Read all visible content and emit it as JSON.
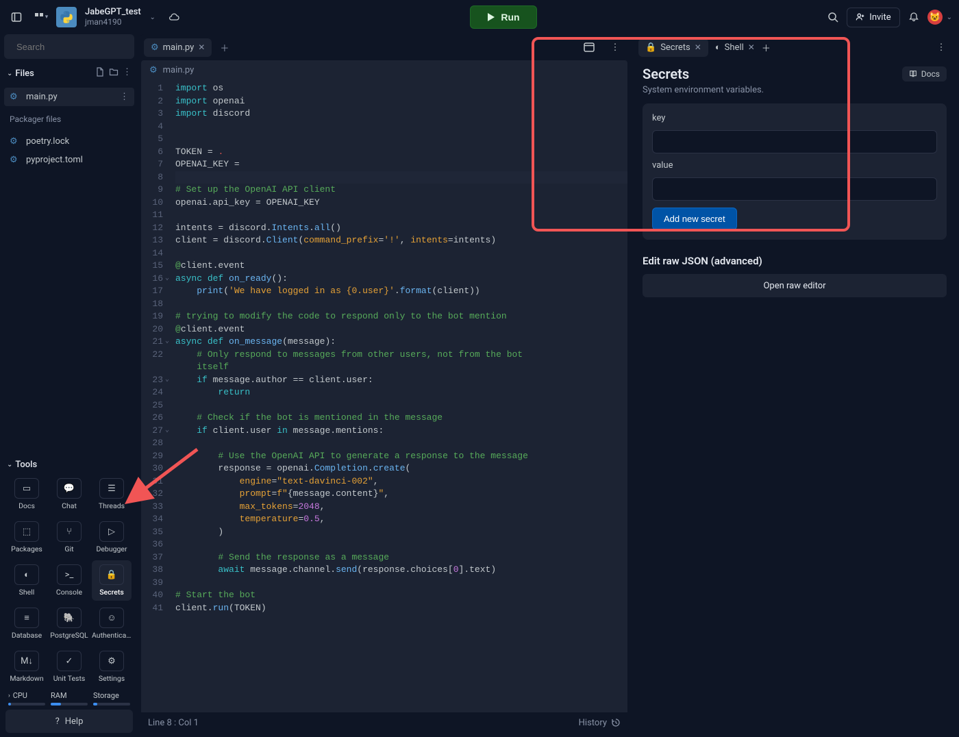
{
  "header": {
    "project_name": "JabeGPT_test",
    "username": "jman4190",
    "run_label": "Run",
    "invite_label": "Invite"
  },
  "sidebar": {
    "search_placeholder": "Search",
    "files_label": "Files",
    "files": [
      {
        "name": "main.py",
        "active": true
      }
    ],
    "packager_label": "Packager files",
    "packager_files": [
      {
        "name": "poetry.lock"
      },
      {
        "name": "pyproject.toml"
      }
    ],
    "tools_label": "Tools",
    "tools": [
      {
        "label": "Docs",
        "glyph": "▭"
      },
      {
        "label": "Chat",
        "glyph": "💬"
      },
      {
        "label": "Threads",
        "glyph": "☰"
      },
      {
        "label": "Packages",
        "glyph": "⬚"
      },
      {
        "label": "Git",
        "glyph": "⑂"
      },
      {
        "label": "Debugger",
        "glyph": "▷"
      },
      {
        "label": "Shell",
        "glyph": "◐"
      },
      {
        "label": "Console",
        "glyph": ">_"
      },
      {
        "label": "Secrets",
        "glyph": "🔒",
        "active": true
      },
      {
        "label": "Database",
        "glyph": "≡"
      },
      {
        "label": "PostgreSQL",
        "glyph": "🐘"
      },
      {
        "label": "Authenticati...",
        "glyph": "☺"
      },
      {
        "label": "Markdown",
        "glyph": "M↓"
      },
      {
        "label": "Unit Tests",
        "glyph": "✓"
      },
      {
        "label": "Settings",
        "glyph": "⚙"
      }
    ],
    "meters": {
      "cpu": {
        "label": "CPU",
        "pct": 8
      },
      "ram": {
        "label": "RAM",
        "pct": 28
      },
      "storage": {
        "label": "Storage",
        "pct": 12
      }
    },
    "help_label": "Help"
  },
  "editor": {
    "tab_label": "main.py",
    "breadcrumb": "main.py",
    "status_left": "Line 8 : Col 1",
    "status_right": "History",
    "lines": [
      {
        "n": 1,
        "html": "<span class='tok-kw'>import</span> os"
      },
      {
        "n": 2,
        "html": "<span class='tok-kw'>import</span> openai"
      },
      {
        "n": 3,
        "html": "<span class='tok-kw'>import</span> discord"
      },
      {
        "n": 4,
        "html": ""
      },
      {
        "n": 5,
        "html": ""
      },
      {
        "n": 6,
        "html": "TOKEN <span class='tok-op'>=</span> <span class='tok-err'>.</span>"
      },
      {
        "n": 7,
        "html": "OPENAI_KEY <span class='tok-op'>=</span> "
      },
      {
        "n": 8,
        "hl": true,
        "html": ""
      },
      {
        "n": 9,
        "html": "<span class='tok-com'># Set up the OpenAI API client</span>"
      },
      {
        "n": 10,
        "html": "openai.api_key <span class='tok-op'>=</span> OPENAI_KEY"
      },
      {
        "n": 11,
        "html": ""
      },
      {
        "n": 12,
        "html": "intents <span class='tok-op'>=</span> discord.<span class='tok-fn'>Intents</span>.<span class='tok-fn'>all</span>()"
      },
      {
        "n": 13,
        "html": "client <span class='tok-op'>=</span> discord.<span class='tok-fn'>Client</span>(<span class='tok-sym'>command_prefix</span>=<span class='tok-str'>'!'</span>, <span class='tok-sym'>intents</span>=intents)"
      },
      {
        "n": 14,
        "html": ""
      },
      {
        "n": 15,
        "html": "<span class='tok-dec'>@</span>client.event"
      },
      {
        "n": 16,
        "fold": true,
        "html": "<span class='tok-kw'>async</span> <span class='tok-kw'>def</span> <span class='tok-fn'>on_ready</span>():"
      },
      {
        "n": 17,
        "html": "    <span class='tok-fn'>print</span>(<span class='tok-str'>'We have logged in as {0.user}'</span>.<span class='tok-fn'>format</span>(client))"
      },
      {
        "n": 18,
        "html": ""
      },
      {
        "n": 19,
        "html": "<span class='tok-com'># trying to modify the code to respond only to the bot mention</span>"
      },
      {
        "n": 20,
        "html": "<span class='tok-dec'>@</span>client.event"
      },
      {
        "n": 21,
        "fold": true,
        "html": "<span class='tok-kw'>async</span> <span class='tok-kw'>def</span> <span class='tok-fn'>on_message</span>(message):"
      },
      {
        "n": 22,
        "html": "    <span class='tok-com'># Only respond to messages from other users, not from the bot\n    itself</span>",
        "multiht": 2
      },
      {
        "n": 23,
        "fold": true,
        "html": "    <span class='tok-kw'>if</span> message.author <span class='tok-op'>==</span> client.user:"
      },
      {
        "n": 24,
        "html": "        <span class='tok-kw'>return</span>"
      },
      {
        "n": 25,
        "html": ""
      },
      {
        "n": 26,
        "html": "    <span class='tok-com'># Check if the bot is mentioned in the message</span>"
      },
      {
        "n": 27,
        "fold": true,
        "html": "    <span class='tok-kw'>if</span> client.user <span class='tok-kw'>in</span> message.mentions:"
      },
      {
        "n": 28,
        "html": ""
      },
      {
        "n": 29,
        "html": "        <span class='tok-com'># Use the OpenAI API to generate a response to the message</span>"
      },
      {
        "n": 30,
        "html": "        response <span class='tok-op'>=</span> openai.<span class='tok-fn'>Completion</span>.<span class='tok-fn'>create</span>("
      },
      {
        "n": 31,
        "html": "            <span class='tok-sym'>engine</span>=<span class='tok-str'>\"text-davinci-002\"</span>,"
      },
      {
        "n": 32,
        "html": "            <span class='tok-sym'>prompt</span>=<span class='tok-str'>f\"</span>{message.content}<span class='tok-str'>\"</span>,"
      },
      {
        "n": 33,
        "html": "            <span class='tok-sym'>max_tokens</span>=<span class='tok-num'>2048</span>,"
      },
      {
        "n": 34,
        "html": "            <span class='tok-sym'>temperature</span>=<span class='tok-num'>0.5</span>,"
      },
      {
        "n": 35,
        "html": "        )"
      },
      {
        "n": 36,
        "html": ""
      },
      {
        "n": 37,
        "html": "        <span class='tok-com'># Send the response as a message</span>"
      },
      {
        "n": 38,
        "html": "        <span class='tok-kw'>await</span> message.channel.<span class='tok-fn'>send</span>(response.choices[<span class='tok-num'>0</span>].text)"
      },
      {
        "n": 39,
        "html": ""
      },
      {
        "n": 40,
        "html": "<span class='tok-com'># Start the bot</span>"
      },
      {
        "n": 41,
        "html": "client.<span class='tok-fn'>run</span>(TOKEN)"
      }
    ]
  },
  "right": {
    "tabs": [
      {
        "label": "Secrets",
        "icon": "🔒",
        "active": true
      },
      {
        "label": "Shell",
        "icon": "◐"
      }
    ],
    "title": "Secrets",
    "subtitle": "System environment variables.",
    "docs_label": "Docs",
    "key_label": "key",
    "value_label": "value",
    "add_label": "Add new secret",
    "adv_title": "Edit raw JSON (advanced)",
    "open_raw_label": "Open raw editor"
  }
}
